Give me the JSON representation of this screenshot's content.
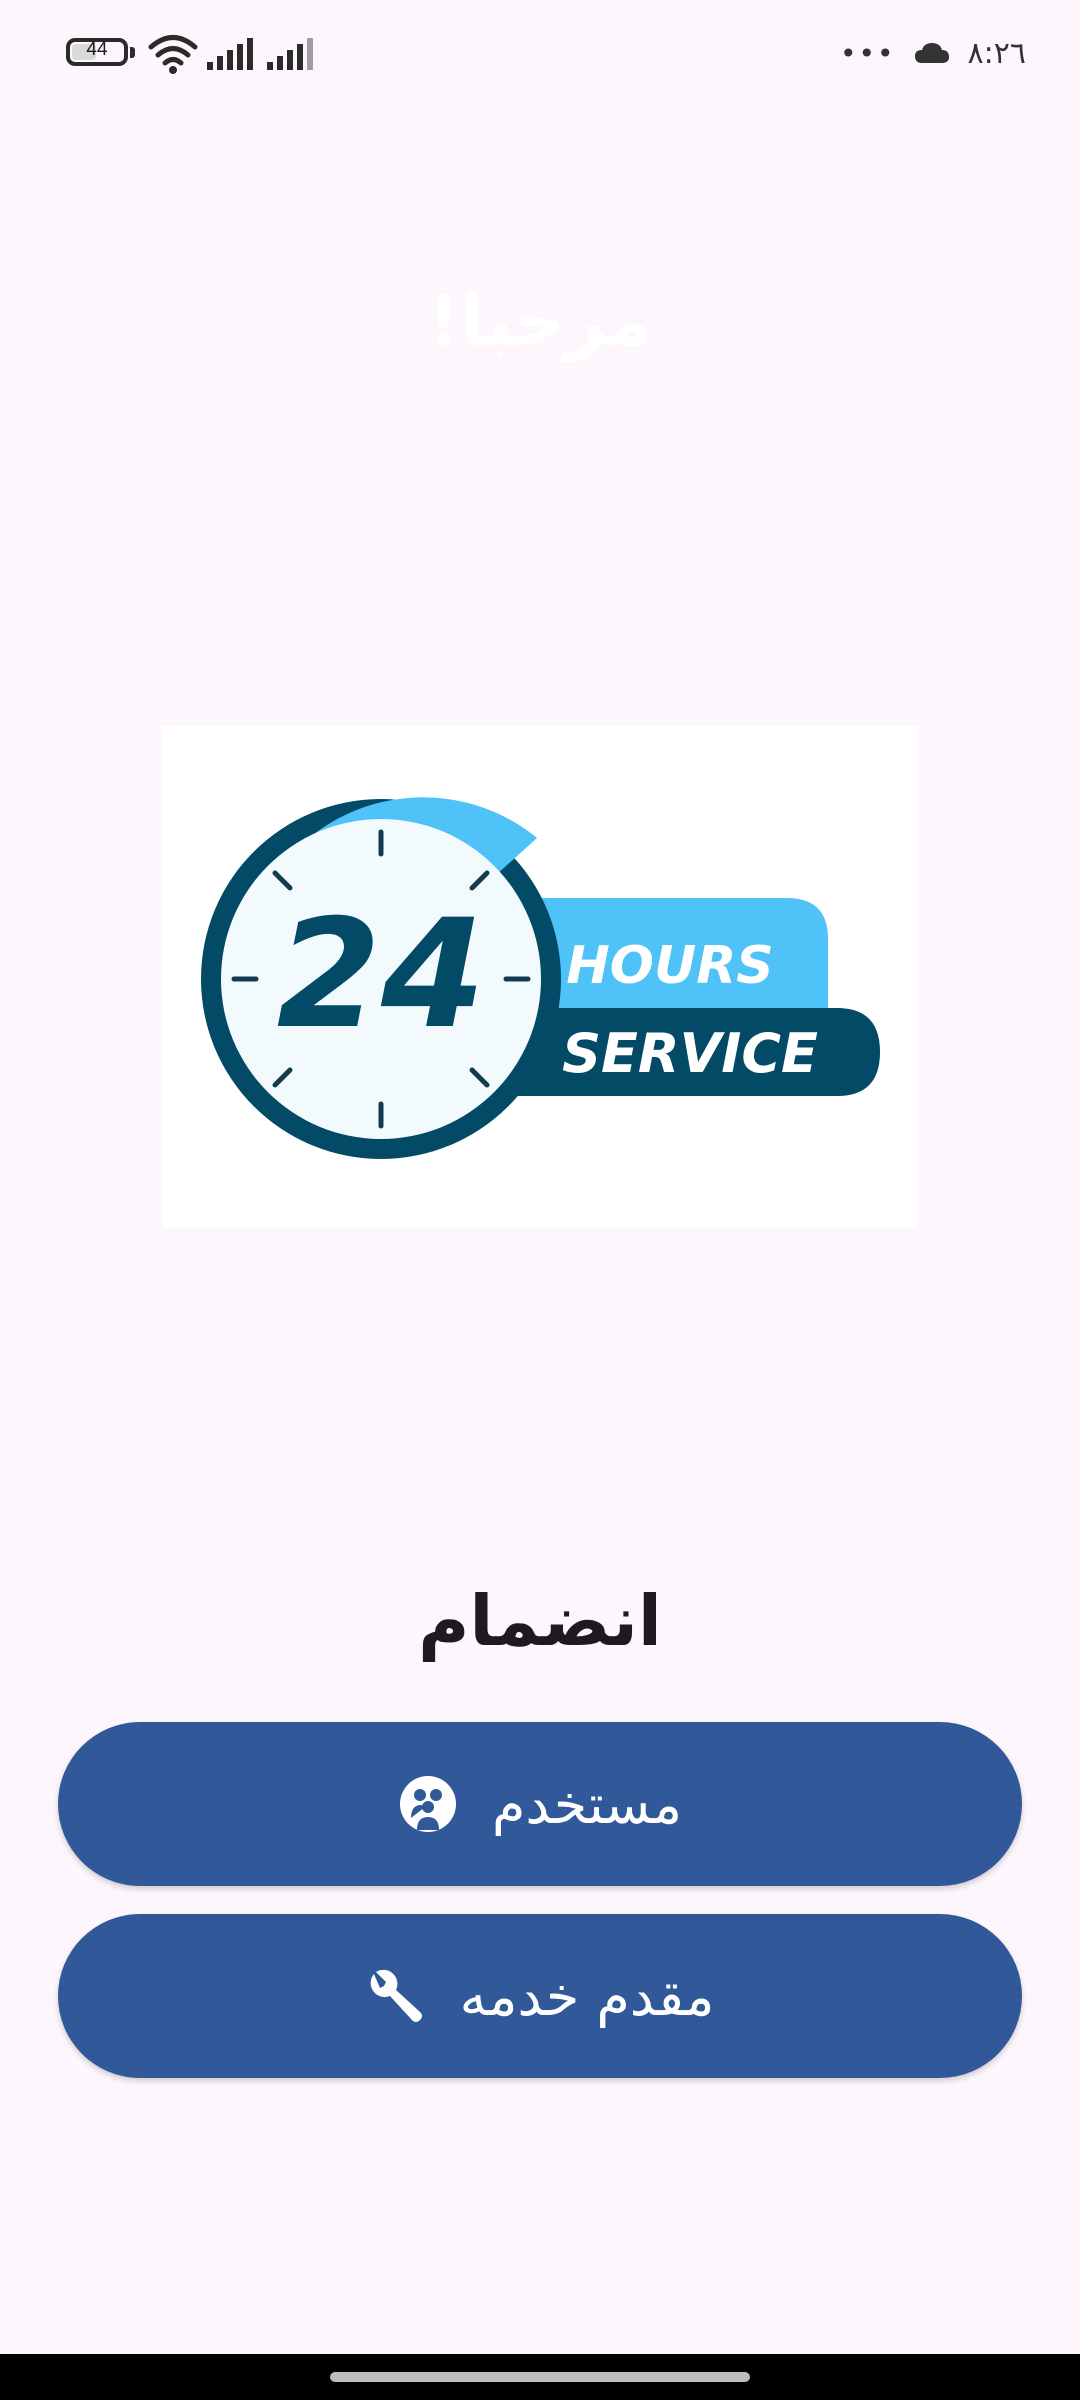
{
  "status_bar": {
    "battery_level": "44",
    "time": "٨:٢٦",
    "overflow": "•••",
    "icons": [
      "battery-icon",
      "wifi-icon",
      "signal-icon",
      "signal-icon",
      "cloud-icon"
    ]
  },
  "header": {
    "title": "مرحبا!"
  },
  "logo": {
    "number": "24",
    "line1": "HOURS",
    "line2": "SERVICE",
    "colors": {
      "light_blue": "#4fc3f7",
      "dark_blue": "#024a66",
      "face": "#f3fafd"
    }
  },
  "join": {
    "title": "انضمام",
    "buttons": [
      {
        "label": "مستخدم",
        "icon": "users-icon"
      },
      {
        "label": "مقدم خدمه",
        "icon": "wrench-icon"
      }
    ]
  },
  "colors": {
    "background": "#fdf6fc",
    "button": "#31599a",
    "title_text": "#1d1b20"
  }
}
